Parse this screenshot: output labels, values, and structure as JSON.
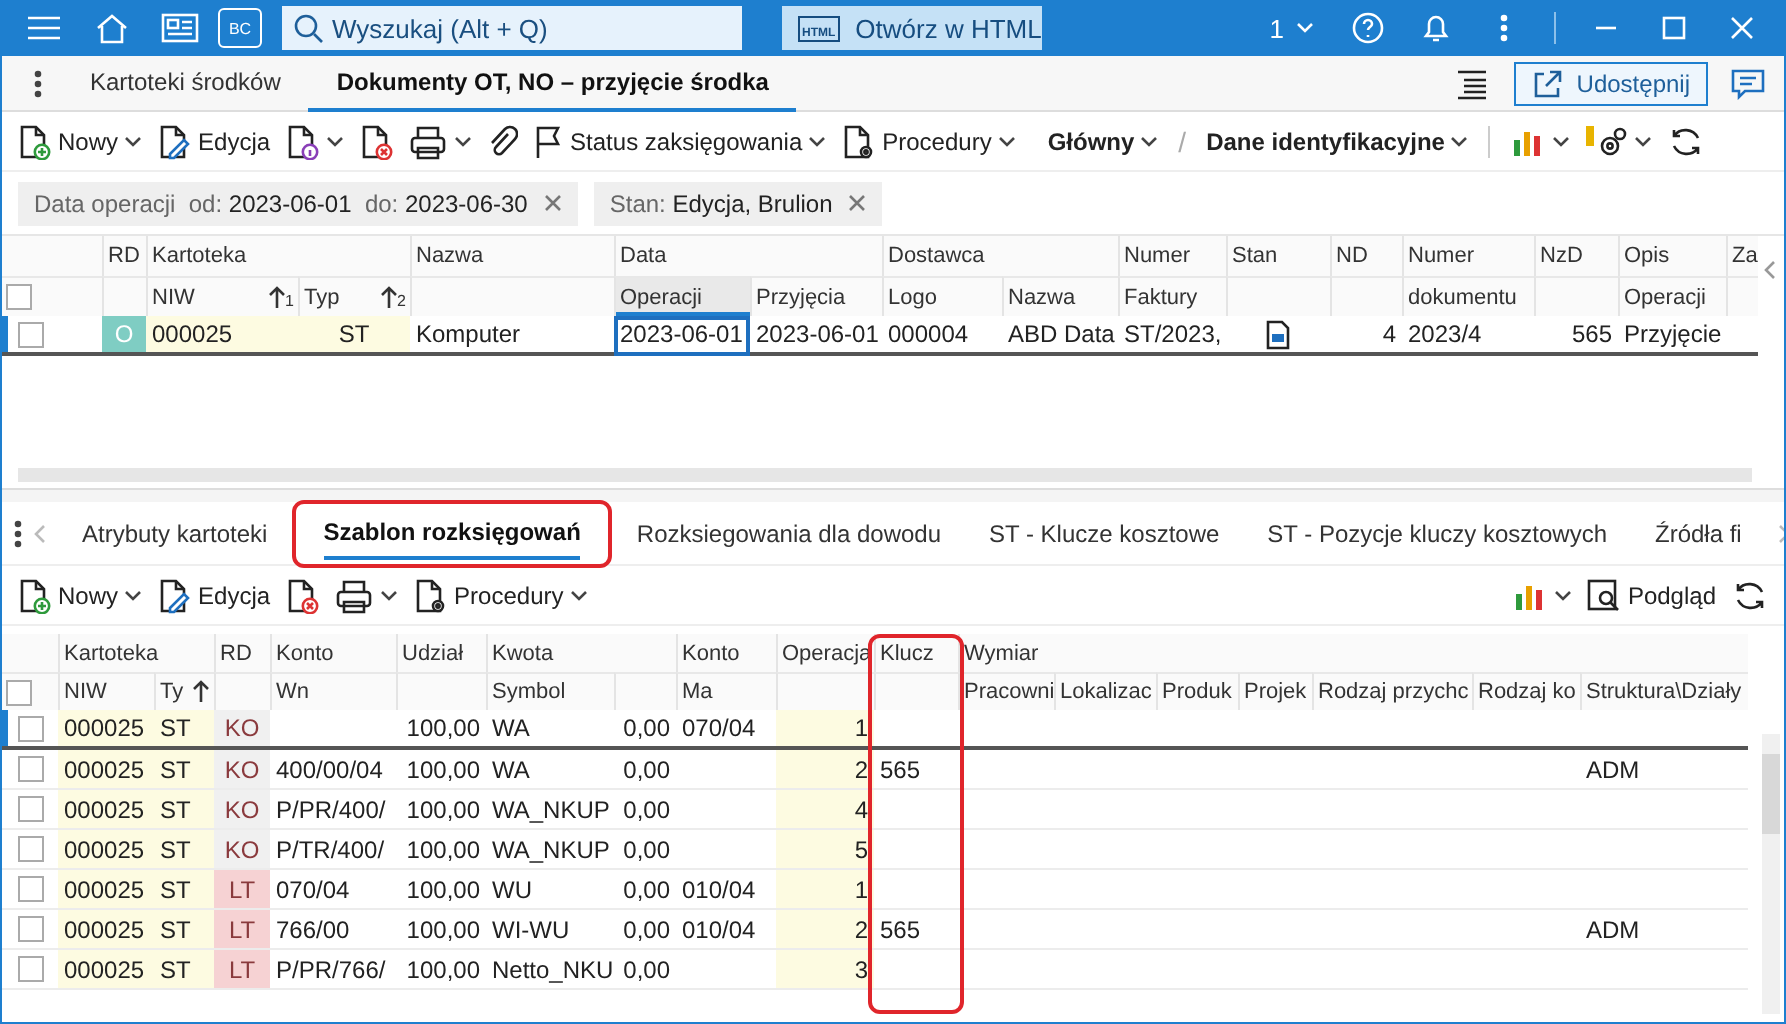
{
  "title_bar": {
    "logo": "BC",
    "search": {
      "placeholder": "Wyszukaj (Alt + Q)"
    },
    "html_button": {
      "badge": "HTML",
      "label": "Otwórz w HTML"
    },
    "company": "1"
  },
  "doc_tabs": {
    "tabs": [
      {
        "label": "Kartoteki środków",
        "selected": false
      },
      {
        "label": "Dokumenty OT, NO – przyjęcie środka",
        "selected": true
      }
    ],
    "share": "Udostępnij"
  },
  "toolbar": {
    "items": [
      {
        "label": "Nowy",
        "dropdown": true
      },
      {
        "label": "Edycja",
        "dropdown": false
      },
      {
        "dropdown": true
      },
      {
        "dropdown": false
      },
      {
        "dropdown": true
      },
      {
        "dropdown": false
      },
      {
        "label": "Status zaksięgowania",
        "dropdown": true
      },
      {
        "label": "Procedury",
        "dropdown": true
      }
    ],
    "views": [
      {
        "label": "Główny"
      },
      {
        "label": "Dane identyfikacyjne"
      }
    ],
    "separator": "/"
  },
  "filters": [
    {
      "text": "Data operacji  od: **2023-06-01**  do: **2023-06-30**"
    },
    {
      "text": "Stan: **Edycja, Brulion**"
    }
  ],
  "upper_table": {
    "groups": [
      {
        "kind": "check",
        "checked": false
      },
      {
        "label": "RD",
        "columns": [
          {}
        ]
      },
      {
        "label": "Kartoteka",
        "columns": [
          {
            "label": "NIW",
            "sorted": true,
            "sort_order": "1"
          },
          {
            "label": "Typ",
            "sorted": true,
            "sort_order": "2"
          }
        ]
      },
      {
        "label": "Nazwa",
        "columns": [
          {}
        ]
      },
      {
        "label": "Data",
        "columns": [
          {
            "label": "Operacji",
            "selected": true
          },
          {
            "label": "Przyjęcia",
            "selected": false
          }
        ]
      },
      {
        "label": "Dostawca",
        "columns": [
          {
            "label": "Logo"
          },
          {
            "label": "Nazwa"
          }
        ]
      },
      {
        "label": "Numer",
        "columns": [
          {
            "label": "Faktury"
          }
        ]
      },
      {
        "label": "Stan",
        "columns": [
          {}
        ]
      },
      {
        "label": "ND",
        "columns": [
          {}
        ]
      },
      {
        "label": "Numer",
        "columns": [
          {
            "label": "dokumentu"
          }
        ]
      },
      {
        "label": "NzD",
        "columns": [
          {}
        ]
      },
      {
        "label": "Opis",
        "columns": [
          {
            "label": "Operacji"
          }
        ]
      },
      {
        "label": "Za",
        "columns": [
          {}
        ]
      }
    ],
    "rows": [
      {
        "checked": false,
        "current": true,
        "rd": {
          "text": "O",
          "color": "#7fcdc3"
        },
        "niw": "000025",
        "typ": "ST",
        "nazwa": "Komputer",
        "data_operacji": "2023-06-01",
        "data_przyjecia": "2023-06-01",
        "logo": "000004",
        "dostawca": "ABD Data",
        "faktura": "ST/2023,",
        "nd": "4",
        "numer": "2023/4",
        "nzd": "565",
        "opis": "Przyjęcie"
      }
    ]
  },
  "detail_tabs": {
    "tabs": [
      {
        "label": "Atrybuty kartoteki",
        "selected": false,
        "highlighted": false
      },
      {
        "label": "Szablon rozksięgowań",
        "selected": true,
        "highlighted": true
      },
      {
        "label": "Rozksiegowania dla dowodu",
        "selected": false,
        "highlighted": false
      },
      {
        "label": "ST - Klucze kosztowe",
        "selected": false,
        "highlighted": false
      },
      {
        "label": "ST - Pozycje kluczy kosztowych",
        "selected": false,
        "highlighted": false
      },
      {
        "label": "Źródła fi",
        "selected": false,
        "highlighted": false
      }
    ]
  },
  "detail_toolbar": {
    "items": [
      {
        "label": "Nowy",
        "dropdown": true
      },
      {
        "label": "Edycja",
        "dropdown": false
      },
      {
        "dropdown": false
      },
      {
        "dropdown": true
      },
      {
        "label": "Procedury",
        "dropdown": true
      }
    ],
    "preview": "Podgląd"
  },
  "lower_table": {
    "groups": [
      {
        "kind": "check",
        "checked": false
      },
      {
        "label": "Kartoteka",
        "columns": [
          {
            "label": "NIW"
          },
          {
            "label": "Ty",
            "sorted": true
          }
        ]
      },
      {
        "label": "RD",
        "columns": [
          {}
        ]
      },
      {
        "label": "Konto",
        "columns": [
          {
            "label": "Wn"
          }
        ]
      },
      {
        "label": "Udział",
        "columns": [
          {}
        ]
      },
      {
        "label": "Kwota",
        "columns": [
          {
            "label": "Symbol"
          },
          {}
        ]
      },
      {
        "label": "Konto",
        "columns": [
          {
            "label": "Ma"
          }
        ]
      },
      {
        "label": "Operacja",
        "columns": [
          {}
        ]
      },
      {
        "label": "Klucz",
        "highlighted": true,
        "columns": [
          {}
        ]
      },
      {
        "label": "Wymiar",
        "columns": [
          {
            "label": "Pracowni"
          },
          {
            "label": "Lokalizac"
          },
          {
            "label": "Produk"
          },
          {
            "label": "Projek"
          },
          {
            "label": "Rodzaj przychc"
          },
          {
            "label": "Rodzaj ko"
          },
          {
            "label": "Struktura\\Działy"
          }
        ]
      }
    ],
    "rows": [
      {
        "checked": false,
        "current": true,
        "niw": "000025",
        "typ": "ST",
        "rd": {
          "text": "KO",
          "color": "#f0f0f0"
        },
        "udzial": "100,00",
        "symbol": "WA",
        "kwota": "0,00",
        "konto_ma": "070/04",
        "operacja": "1"
      },
      {
        "checked": false,
        "current": false,
        "niw": "000025",
        "typ": "ST",
        "rd": {
          "text": "KO",
          "color": "#f0f0f0"
        },
        "konto_wn": "400/00/04",
        "udzial": "100,00",
        "symbol": "WA",
        "kwota": "0,00",
        "operacja": "2",
        "klucz": "565",
        "struktura": "ADM"
      },
      {
        "checked": false,
        "current": false,
        "niw": "000025",
        "typ": "ST",
        "rd": {
          "text": "KO",
          "color": "#f0f0f0"
        },
        "konto_wn": "P/PR/400/",
        "udzial": "100,00",
        "symbol": "WA_NKUP",
        "kwota": "0,00",
        "operacja": "4"
      },
      {
        "checked": false,
        "current": false,
        "niw": "000025",
        "typ": "ST",
        "rd": {
          "text": "KO",
          "color": "#f0f0f0"
        },
        "konto_wn": "P/TR/400/",
        "udzial": "100,00",
        "symbol": "WA_NKUP",
        "kwota": "0,00",
        "operacja": "5"
      },
      {
        "checked": false,
        "current": false,
        "niw": "000025",
        "typ": "ST",
        "rd": {
          "text": "LT",
          "color": "#f6d2d3"
        },
        "konto_wn": "070/04",
        "udzial": "100,00",
        "symbol": "WU",
        "kwota": "0,00",
        "konto_ma": "010/04",
        "operacja": "1"
      },
      {
        "checked": false,
        "current": false,
        "niw": "000025",
        "typ": "ST",
        "rd": {
          "text": "LT",
          "color": "#f6d2d3"
        },
        "konto_wn": "766/00",
        "udzial": "100,00",
        "symbol": "WI-WU",
        "kwota": "0,00",
        "konto_ma": "010/04",
        "operacja": "2",
        "klucz": "565",
        "struktura": "ADM"
      },
      {
        "checked": false,
        "current": false,
        "niw": "000025",
        "typ": "ST",
        "rd": {
          "text": "LT",
          "color": "#f6d2d3"
        },
        "konto_wn": "P/PR/766/",
        "udzial": "100,00",
        "symbol": "Netto_NKU",
        "kwota": "0,00",
        "operacja": "3"
      }
    ]
  }
}
